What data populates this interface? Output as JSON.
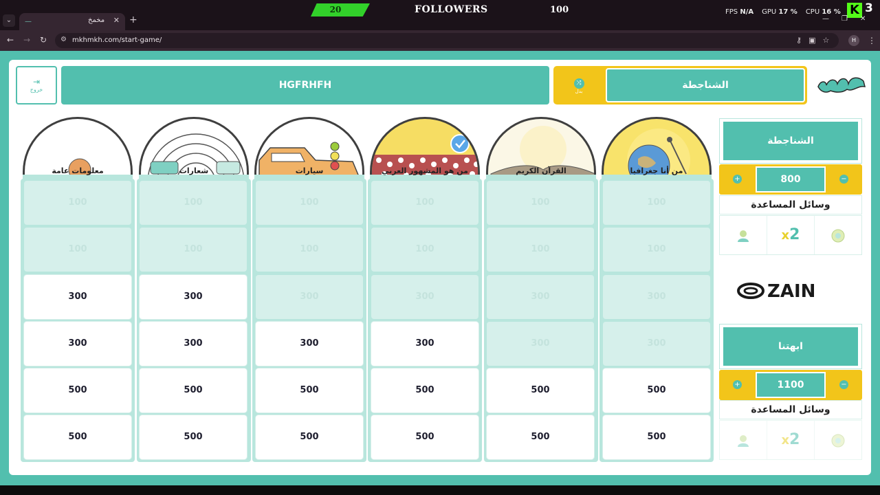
{
  "browser": {
    "tab_title": "مخمخ",
    "url": "mkhmkh.com/start-game/"
  },
  "overlay": {
    "count_left": "20",
    "label": "FOLLOWERS",
    "count_right": "100",
    "fps_label": "FPS",
    "fps_value": "N/A",
    "gpu_label": "GPU",
    "gpu_value": "17 %",
    "cpu_label": "CPU",
    "cpu_value": "16 %",
    "k_number": "3"
  },
  "game": {
    "exit_label": "خروج",
    "current_team_banner": "HGFRHFH",
    "turn_label": "بدل",
    "turn_team": "الشناجطة"
  },
  "categories": [
    {
      "label": "معلومات عامة"
    },
    {
      "label": "شعارات"
    },
    {
      "label": "سيارات"
    },
    {
      "label": "من هو المشهور العربي"
    },
    {
      "label": "القرآن الكريم"
    },
    {
      "label": "من أنا جغرافيا"
    }
  ],
  "grid": [
    [
      {
        "v": "100",
        "state": "used"
      },
      {
        "v": "100",
        "state": "used"
      },
      {
        "v": "100",
        "state": "used"
      },
      {
        "v": "100",
        "state": "used"
      },
      {
        "v": "100",
        "state": "used"
      },
      {
        "v": "100",
        "state": "used"
      }
    ],
    [
      {
        "v": "100",
        "state": "used"
      },
      {
        "v": "100",
        "state": "used"
      },
      {
        "v": "100",
        "state": "used"
      },
      {
        "v": "100",
        "state": "used"
      },
      {
        "v": "100",
        "state": "used"
      },
      {
        "v": "100",
        "state": "used"
      }
    ],
    [
      {
        "v": "300",
        "state": "active"
      },
      {
        "v": "300",
        "state": "active"
      },
      {
        "v": "300",
        "state": "used"
      },
      {
        "v": "300",
        "state": "used"
      },
      {
        "v": "300",
        "state": "used"
      },
      {
        "v": "300",
        "state": "used"
      }
    ],
    [
      {
        "v": "300",
        "state": "active"
      },
      {
        "v": "300",
        "state": "active"
      },
      {
        "v": "300",
        "state": "active"
      },
      {
        "v": "300",
        "state": "active"
      },
      {
        "v": "300",
        "state": "used"
      },
      {
        "v": "300",
        "state": "used"
      }
    ],
    [
      {
        "v": "500",
        "state": "active"
      },
      {
        "v": "500",
        "state": "active"
      },
      {
        "v": "500",
        "state": "active"
      },
      {
        "v": "500",
        "state": "active"
      },
      {
        "v": "500",
        "state": "active"
      },
      {
        "v": "500",
        "state": "active"
      }
    ],
    [
      {
        "v": "500",
        "state": "active"
      },
      {
        "v": "500",
        "state": "active"
      },
      {
        "v": "500",
        "state": "active"
      },
      {
        "v": "500",
        "state": "active"
      },
      {
        "v": "500",
        "state": "active"
      },
      {
        "v": "500",
        "state": "active"
      }
    ]
  ],
  "teams": [
    {
      "name": "الشناجطة",
      "score": "800",
      "aids_title": "وسائل المساعدة"
    },
    {
      "name": "ابهتنا",
      "score": "1100",
      "aids_title": "وسائل المساعدة"
    }
  ],
  "icons": {
    "plus": "+",
    "minus": "−",
    "x2": "x2"
  },
  "colors": {
    "primary_teal": "#52bfae",
    "accent_yellow": "#f2c51a",
    "used_cell": "#d6f0eb"
  }
}
